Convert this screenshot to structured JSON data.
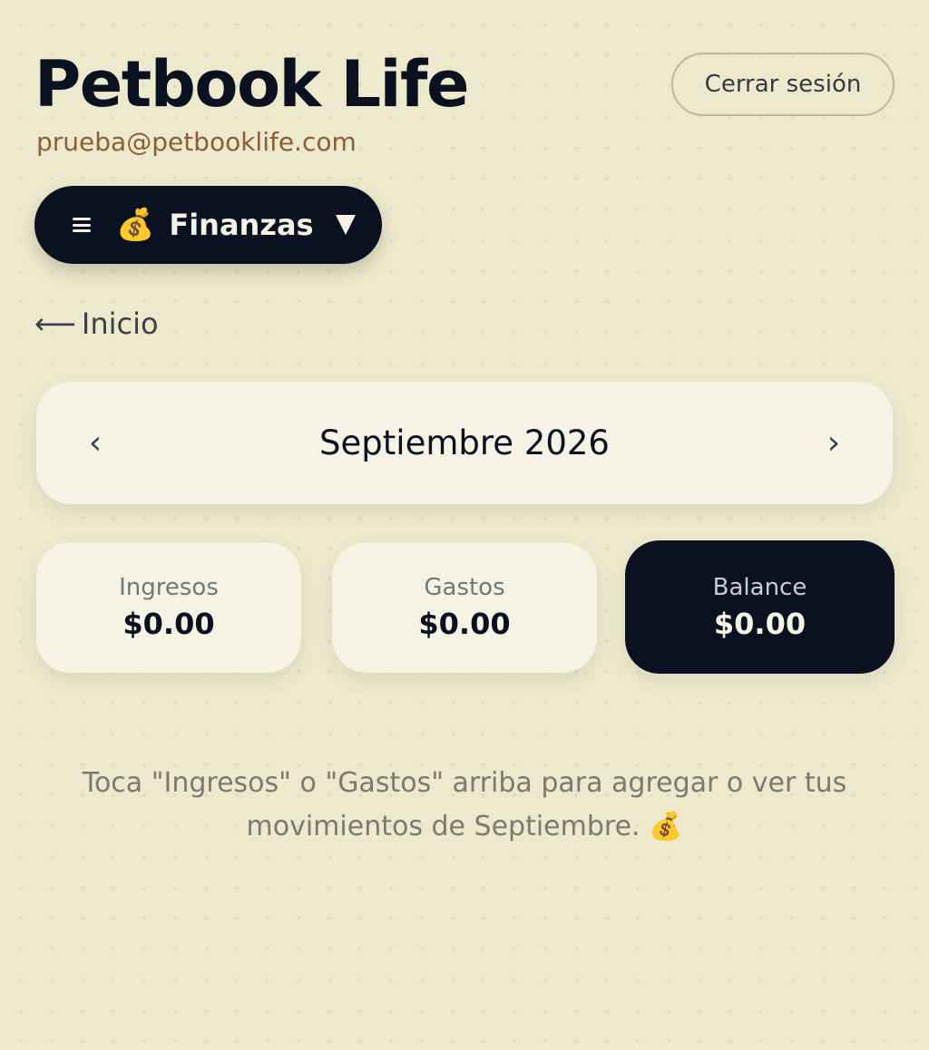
{
  "header": {
    "title": "Petbook Life",
    "email": "prueba@petbooklife.com",
    "logout_label": "Cerrar sesión"
  },
  "section_menu": {
    "label": "Finanzas",
    "emoji": "💰"
  },
  "nav": {
    "back_arrow": "⟵",
    "back_label": "Inicio"
  },
  "month_selector": {
    "prev": "‹",
    "label": "Septiembre 2026",
    "next": "›"
  },
  "stats": {
    "income": {
      "label": "Ingresos",
      "value": "$0.00"
    },
    "expenses": {
      "label": "Gastos",
      "value": "$0.00"
    },
    "balance": {
      "label": "Balance",
      "value": "$0.00"
    }
  },
  "hint": {
    "text": "Toca \"Ingresos\" o \"Gastos\" arriba para agregar o ver tus movimientos de Septiembre.",
    "emoji": "💰"
  },
  "colors": {
    "background": "#ECE9CD",
    "dark": "#0A1221",
    "card": "#F5F3E4",
    "email": "#8B5E34"
  }
}
